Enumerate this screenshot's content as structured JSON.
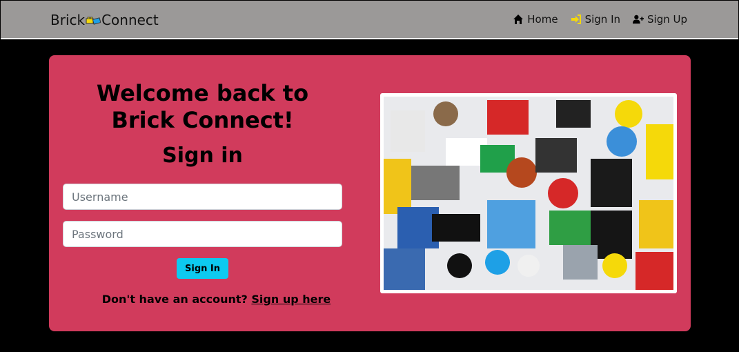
{
  "nav": {
    "brand_left": "Brick",
    "brand_right": "Connect",
    "links": [
      {
        "label": "Home",
        "icon": "home-icon"
      },
      {
        "label": "Sign In",
        "icon": "sign-in-icon"
      },
      {
        "label": "Sign Up",
        "icon": "user-plus-icon"
      }
    ]
  },
  "form": {
    "heading": "Welcome back to Brick Connect!",
    "subheading": "Sign in",
    "username_placeholder": "Username",
    "password_placeholder": "Password",
    "submit_label": "Sign In",
    "prompt": "Don't have an account?",
    "signup_link": "Sign up here"
  },
  "colors": {
    "navbar": "#9b9998",
    "card": "#d13b5c",
    "button": "#0dcaf0",
    "icon_accent": "#f5d90a"
  }
}
